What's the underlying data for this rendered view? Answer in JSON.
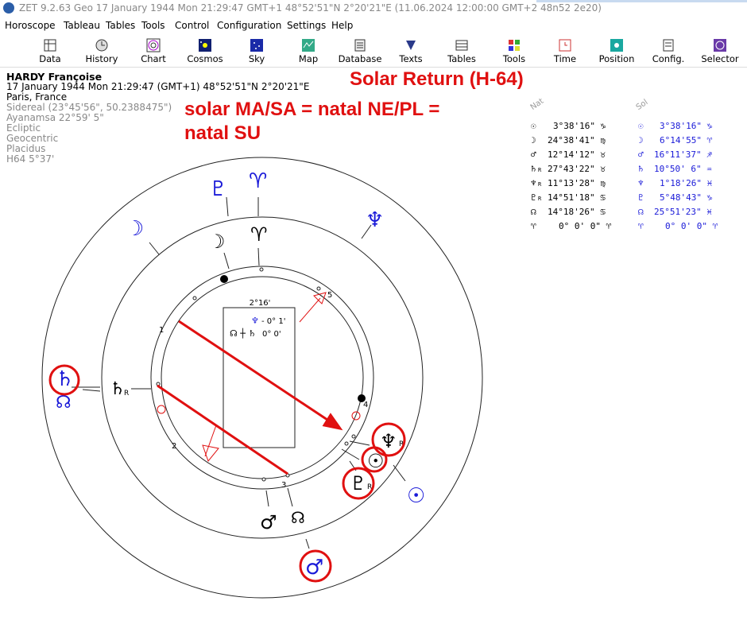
{
  "window": {
    "title": "ZET 9.2.63 Geo    17 January 1944  Mon  21:29:47 GMT+1 48°52'51\"N  2°20'21\"E  (11.06.2024  12:00:00 GMT+2 48n52 2e20)"
  },
  "menu": [
    "Horoscope",
    "Tableau",
    "Tables",
    "Tools",
    "Control",
    "Configuration",
    "Settings",
    "Help"
  ],
  "toolbar": [
    {
      "label": "Data",
      "icon": "data-icon"
    },
    {
      "label": "History",
      "icon": "history-icon"
    },
    {
      "label": "Chart",
      "icon": "chart-icon"
    },
    {
      "label": "Cosmos",
      "icon": "cosmos-icon"
    },
    {
      "label": "Sky",
      "icon": "sky-icon"
    },
    {
      "label": "Map",
      "icon": "map-icon"
    },
    {
      "label": "Database",
      "icon": "database-icon"
    },
    {
      "label": "Texts",
      "icon": "texts-icon"
    },
    {
      "label": "Tables",
      "icon": "tables-icon"
    },
    {
      "label": "Tools",
      "icon": "tools-icon"
    },
    {
      "label": "Time",
      "icon": "time-icon"
    },
    {
      "label": "Position",
      "icon": "position-icon"
    },
    {
      "label": "Config.",
      "icon": "config-icon"
    },
    {
      "label": "Selector",
      "icon": "selector-icon"
    }
  ],
  "info": {
    "name": "HARDY Françoise",
    "datetime": "17 January 1944  Mon  21:29:47  (GMT+1)  48°52'51\"N  2°20'21\"E",
    "place": "Paris, France",
    "settings": [
      "Sidereal (23°45'56\", 50.2388475\")",
      "Ayanamsa 22°59' 5\"",
      "Ecliptic",
      "Geocentric",
      "Placidus",
      "H64   5°37'"
    ]
  },
  "annotation": {
    "title": "Solar Return (H-64)",
    "line1": "solar MA/SA = natal NE/PL =",
    "line2": "natal SU"
  },
  "table": {
    "header_natal": "Nat",
    "header_solar": "Sol",
    "rows": [
      {
        "glyph": "☉",
        "natal": "3°38'16\" ♑",
        "solar": "3°38'16\" ♑"
      },
      {
        "glyph": "☽",
        "natal": "24°38'41\" ♍",
        "solar": "6°14'55\" ♈"
      },
      {
        "glyph": "♂",
        "natal": "12°14'12\" ♉",
        "solar": "16°11'37\" ♐"
      },
      {
        "glyph": "♄",
        "glyph_r": "R",
        "natal": "27°43'22\" ♉",
        "solar": "10°50' 6\" ♒"
      },
      {
        "glyph": "♆",
        "glyph_r": "R",
        "natal": "11°13'28\" ♍",
        "solar": "1°18'26\" ♓"
      },
      {
        "glyph": "♇",
        "glyph_r": "R",
        "natal": "14°51'18\" ♋",
        "solar": "5°48'43\" ♑"
      },
      {
        "glyph": "☊",
        "natal": "14°18'26\" ♋",
        "solar": "25°51'23\" ♓"
      },
      {
        "glyph": "♈",
        "natal": "0° 0' 0\" ♈",
        "solar": "0° 0' 0\" ♈"
      }
    ]
  },
  "chart": {
    "center_box": {
      "title": "2°16'",
      "line1_glyph": "♆",
      "line1_value": "- 0° 1'",
      "line2_glyph": "☊ ┼ ♄",
      "line2_value": "0° 0'"
    },
    "house_numbers": [
      "1",
      "2",
      "3",
      "4",
      "5"
    ],
    "glyphs": {
      "pluto_outer": "♇",
      "aries_outer": "♈",
      "neptune_outer": "♆",
      "moon_outer": "☽",
      "moon_inner": "☽",
      "aries_inner": "♈",
      "saturn_outer": "♄",
      "node_outer": "☊",
      "saturn_inner": "♄",
      "saturn_inner_r": "R",
      "neptune_inner": "♆",
      "neptune_inner_r": "R",
      "sun_inner": "☉",
      "pluto_inner": "♇",
      "pluto_inner_r": "R",
      "sun_outer": "☉",
      "mars_inner": "♂",
      "node_inner": "☊",
      "mars_outer": "♂"
    },
    "colors": {
      "natal": "#1a1ad8",
      "solar": "#000000",
      "highlight": "#e01010"
    }
  }
}
